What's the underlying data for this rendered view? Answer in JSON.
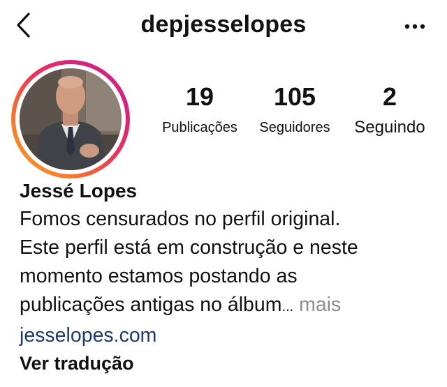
{
  "header": {
    "back_icon": "chevron-left-icon",
    "username": "depjesselopes",
    "more_icon": "more-horizontal-icon"
  },
  "profile": {
    "avatar_icon": "profile-photo",
    "ring_colors": [
      "#f9a23a",
      "#e9315d",
      "#c1328e"
    ]
  },
  "stats": [
    {
      "value": "19",
      "label": "Publicações"
    },
    {
      "value": "105",
      "label": "Seguidores"
    },
    {
      "value": "2",
      "label": "Seguindo"
    }
  ],
  "bio": {
    "name": "Jessé Lopes",
    "lines": [
      "Fomos censurados no perfil original.",
      "Este perfil está em construção e neste",
      "momento estamos postando as",
      "publicações antigas no álbum"
    ],
    "ellipsis": "...",
    "more_label": " mais",
    "website": "jesselopes.com",
    "translate_label": "Ver tradução"
  },
  "colors": {
    "link": "#1d3a6e",
    "muted": "#8e8e8e",
    "text": "#111111"
  }
}
